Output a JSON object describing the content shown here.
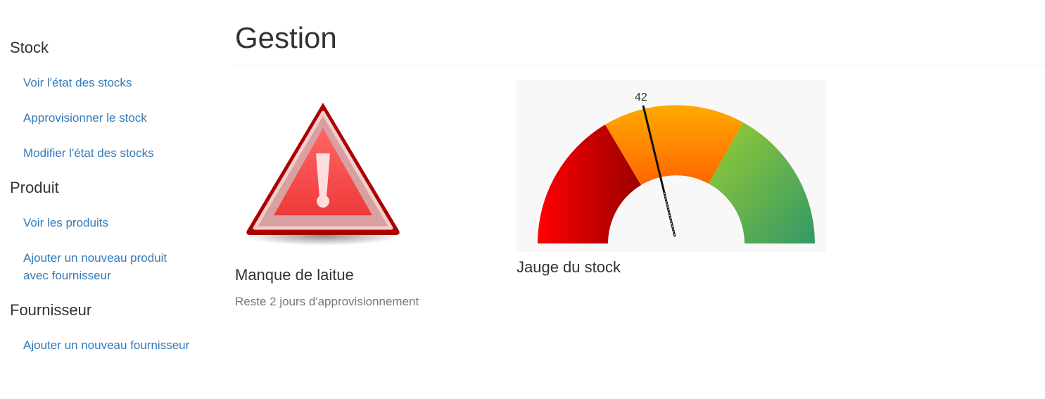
{
  "sidebar": {
    "sections": [
      {
        "title": "Stock",
        "items": [
          {
            "label": "Voir l'état des stocks"
          },
          {
            "label": "Approvisionner le stock"
          },
          {
            "label": "Modifier l'état des stocks"
          }
        ]
      },
      {
        "title": "Produit",
        "items": [
          {
            "label": "Voir les produits"
          },
          {
            "label": "Ajouter un nouveau produit avec fournisseur"
          }
        ]
      },
      {
        "title": "Fournisseur",
        "items": [
          {
            "label": "Ajouter un nouveau fournisseur"
          }
        ]
      }
    ]
  },
  "main": {
    "title": "Gestion",
    "cards": [
      {
        "icon": "warning-icon",
        "title": "Manque de laitue",
        "text": "Reste 2 jours d'approvisionnement"
      },
      {
        "icon": "gauge",
        "title": "Jauge du stock",
        "gauge_value": "42"
      }
    ]
  },
  "colors": {
    "link": "#337ab7",
    "gauge_red": "#cc0000",
    "gauge_orange": "#ff9900",
    "gauge_green": "#66bb44"
  }
}
